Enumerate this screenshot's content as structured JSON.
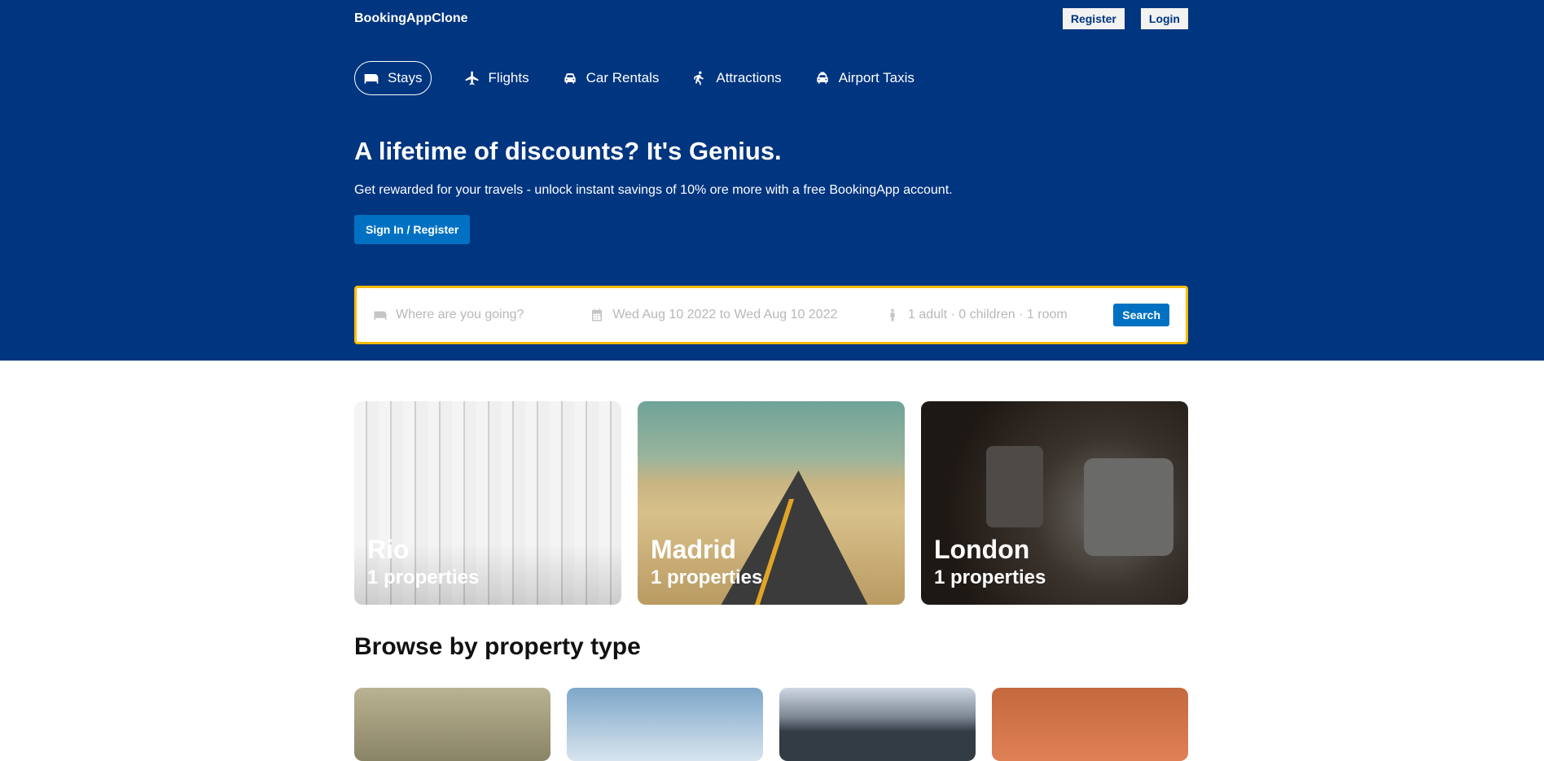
{
  "navbar": {
    "logo": "BookingAppClone",
    "register": "Register",
    "login": "Login"
  },
  "tabs": [
    {
      "label": "Stays",
      "icon": "bed-icon",
      "active": true
    },
    {
      "label": "Flights",
      "icon": "plane-icon"
    },
    {
      "label": "Car Rentals",
      "icon": "car-icon"
    },
    {
      "label": "Attractions",
      "icon": "person-walking-icon"
    },
    {
      "label": "Airport Taxis",
      "icon": "taxi-icon"
    }
  ],
  "hero": {
    "title": "A lifetime of discounts? It's Genius.",
    "desc": "Get rewarded for your travels - unlock instant savings of 10% ore more with a free BookingApp account.",
    "cta": "Sign In / Register"
  },
  "search": {
    "destination_placeholder": "Where are you going?",
    "date_range": "Wed Aug 10 2022 to Wed Aug 10 2022",
    "options": "1 adult · 0 children · 1 room",
    "button": "Search"
  },
  "featured": [
    {
      "city": "Rio",
      "count": "1 properties"
    },
    {
      "city": "Madrid",
      "count": "1 properties"
    },
    {
      "city": "London",
      "count": "1 properties"
    }
  ],
  "browse": {
    "title": "Browse by property type"
  },
  "colors": {
    "header": "#003580",
    "accent": "#0071c2",
    "search_border": "#febb02"
  }
}
